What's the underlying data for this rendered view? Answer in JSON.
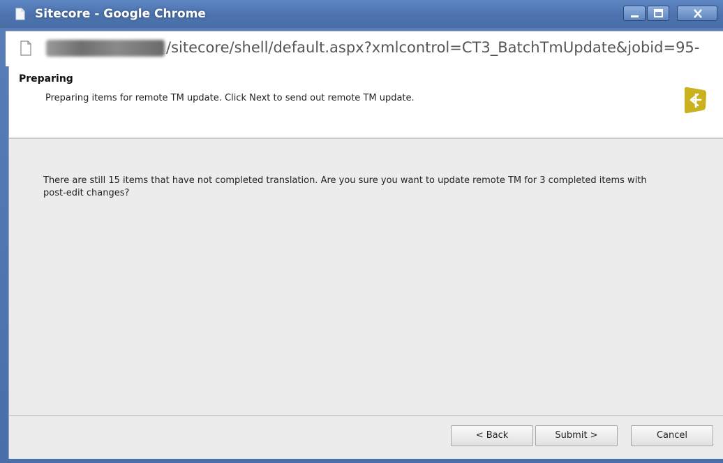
{
  "window": {
    "title": "Sitecore - Google Chrome",
    "icons": [
      "page-icon",
      "minimize-icon",
      "maximize-icon",
      "close-icon"
    ]
  },
  "address": {
    "url_visible": "/sitecore/shell/default.aspx?xmlcontrol=CT3_BatchTmUpdate&jobid=95-",
    "icon": "page-icon"
  },
  "dialog": {
    "header_title": "Preparing",
    "header_description": "Preparing items for remote TM update. Click Next to send out remote TM update.",
    "logo_icon": "sitecore-logo-icon",
    "message": "There are still 15 items that have not completed translation. Are you sure you want to update remote TM for 3 completed items with post-edit changes?",
    "buttons": {
      "back": "< Back",
      "submit": "Submit >",
      "cancel": "Cancel"
    }
  },
  "colors": {
    "titlebar": "#4c72ae",
    "dialog_bg": "#ececec",
    "logo": "#c9b21e"
  }
}
